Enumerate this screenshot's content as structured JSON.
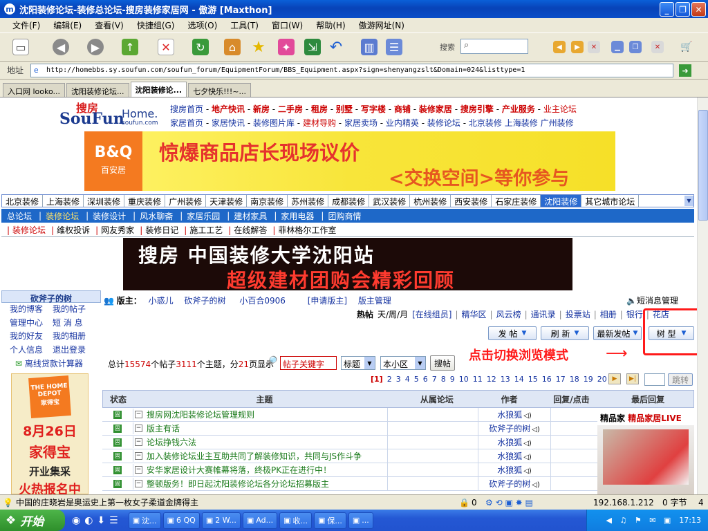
{
  "window": {
    "title": "沈阳装修论坛-装修总论坛-搜房装修家居网 - 傲游 [Maxthon]"
  },
  "menu": [
    "文件(F)",
    "编辑(E)",
    "查看(V)",
    "快捷组(G)",
    "选项(O)",
    "工具(T)",
    "窗口(W)",
    "帮助(H)",
    "傲游网址(N)"
  ],
  "toolbar": {
    "search_label": "搜索"
  },
  "address": {
    "label": "地址",
    "url": "http://homebbs.sy.soufun.com/soufun_forum/EquipmentForum/BBS_Equipment.aspx?sign=shenyangzslt&Domain=024&listtype=1"
  },
  "tabs": [
    {
      "label": "入口网 looko..."
    },
    {
      "label": "沈阳装修论坛..."
    },
    {
      "label": "沈阳装修论..."
    },
    {
      "label": "七夕快乐!!!~..."
    }
  ],
  "site": {
    "logo_main": "SouFun",
    "logo_sub": "Home.",
    "logo_domain": "soufun.com",
    "logo_cn": "搜房",
    "nav1": [
      "搜房首页",
      "地产快讯",
      "新房",
      "二手房",
      "租房",
      "别墅",
      "写字楼",
      "商铺",
      "装修家居",
      "搜房引擎",
      "产业服务",
      "业主论坛"
    ],
    "nav2": [
      "家居首页",
      "家居快讯",
      "装修图片库",
      "建材导购",
      "家居卖场",
      "业内精英",
      "装修论坛",
      "北京装修",
      "上海装修",
      "广州装修"
    ],
    "banner1": {
      "brand": "B&Q",
      "brand_cn": "百安居",
      "headline": "惊爆商品店长现场议价",
      "sub": "<交换空间>等你参与"
    },
    "cities": [
      "北京装修",
      "上海装修",
      "深圳装修",
      "重庆装修",
      "广州装修",
      "天津装修",
      "南京装修",
      "苏州装修",
      "成都装修",
      "武汉装修",
      "杭州装修",
      "西安装修",
      "石家庄装修",
      "沈阳装修",
      "其它城市论坛"
    ],
    "subnav": [
      "总论坛",
      "装修论坛",
      "装修设计",
      "风水聊斋",
      "家居乐园",
      "建材家具",
      "家用电器",
      "团购商情"
    ],
    "subnav2": [
      "装修论坛",
      "维权投诉",
      "网友秀家",
      "装修日记",
      "施工工艺",
      "在线解答",
      "菲林格尔工作室"
    ],
    "banner2": {
      "line1": "搜房 中国装修大学沈阳站",
      "line2": "超级建材团购会精彩回顾"
    }
  },
  "sidebar": {
    "title": "砍斧子的树",
    "links": [
      [
        "我的博客",
        "我的帖子"
      ],
      [
        "管理中心",
        "短 消 息"
      ],
      [
        "我的好友",
        "我的相册"
      ],
      [
        "个人信息",
        "退出登录"
      ]
    ],
    "calc": "离线贷款计算器",
    "ad": {
      "brand": "THE HOME DEPOT",
      "brand_cn": "家得宝",
      "date": "8月26日",
      "name": "家得宝",
      "open": "开业集采",
      "signup": "火热报名中"
    }
  },
  "forum": {
    "moderators_label": "版主：",
    "moderators": [
      "小惑儿",
      "砍斧子的树",
      "小百合0906"
    ],
    "apply": "[申请版主]",
    "manage": "版主管理",
    "sms": "短消息管理",
    "hot_label": "热帖",
    "links": [
      "天/周/月",
      "[在线组员]",
      "精华区",
      "风云榜",
      "通讯录",
      "投票站",
      "相册",
      "银行",
      "花店"
    ],
    "buttons": [
      "发 帖",
      "刷 新",
      "最新发帖",
      "树 型"
    ],
    "annotation": "点击切换浏览模式",
    "stats_text": {
      "prefix": "总计",
      "posts": "15574",
      "mid1": "个帖子",
      "topics": "3111",
      "mid2": "个主题，分",
      "pages": "21",
      "suffix": "页显示"
    },
    "search_placeholder": "帖子关键字",
    "search_field": "标题",
    "search_scope": "本小区",
    "search_button": "搜帖",
    "pages": [
      "[1]",
      "2",
      "3",
      "4",
      "5",
      "6",
      "7",
      "8",
      "9",
      "10",
      "11",
      "12",
      "13",
      "14",
      "15",
      "16",
      "17",
      "18",
      "19",
      "20"
    ],
    "goto": "跳转",
    "columns": [
      "状态",
      "主题",
      "从属论坛",
      "作者",
      "回复/点击",
      "最后回复"
    ],
    "rows": [
      {
        "title": "搜房网沈阳装修论坛管理规则",
        "author": "水狼狐"
      },
      {
        "title": "版主有话",
        "author": "砍斧子的树"
      },
      {
        "title": "论坛挣钱六法",
        "author": "水狼狐"
      },
      {
        "title": "加入装修论坛业主互助共同了解装修知识，共同与JS作斗争",
        "author": "水狼狐"
      },
      {
        "title": "安华家居设计大赛帷幕将落，终极PK正在进行中！",
        "author": "水狼狐"
      },
      {
        "title": "整顿版务！即日起沈阳装修论坛各分论坛招募版主",
        "author": "砍斧子的树"
      }
    ],
    "right_ad": {
      "brand": "精品家",
      "text": "精品家居LIVE"
    }
  },
  "status": {
    "text": "中国的庄晓岩是奥运史上第一枚女子柔道金牌得主",
    "zero1": "0",
    "ip": "192.168.1.212",
    "bytes": "0 字节",
    "num": "4"
  },
  "taskbar": {
    "start": "开始",
    "tasks": [
      "沈...",
      "6 QQ",
      "2 W...",
      "Ad...",
      "收...",
      "保...",
      "..."
    ],
    "clock": "17:13"
  }
}
